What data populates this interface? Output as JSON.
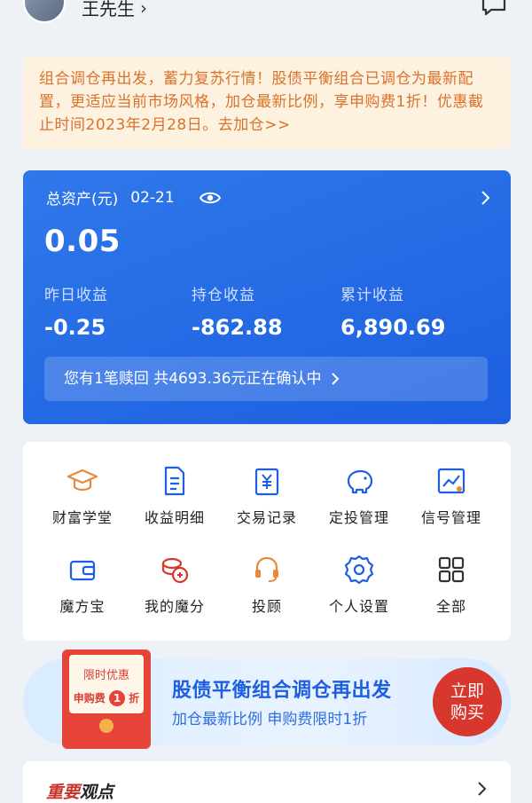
{
  "header": {
    "username": "王先生"
  },
  "notice": {
    "text": "组合调仓再出发，蓄力复苏行情！股债平衡组合已调仓为最新配置，更适应当前市场风格，加仓最新比例，享申购费1折！优惠截止时间2023年2月28日。去加仓>>"
  },
  "asset": {
    "label": "总资产(元)",
    "date": "02-21",
    "total": "0.05",
    "yesterday_label": "昨日收益",
    "yesterday_value": "-0.25",
    "holding_label": "持仓收益",
    "holding_value": "-862.88",
    "cumulative_label": "累计收益",
    "cumulative_value": "6,890.69",
    "redeem_text": "您有1笔赎回 共4693.36元正在确认中"
  },
  "grid": {
    "items": [
      {
        "label": "财富学堂",
        "icon": "graduation-cap-icon"
      },
      {
        "label": "收益明细",
        "icon": "document-icon"
      },
      {
        "label": "交易记录",
        "icon": "yuan-record-icon"
      },
      {
        "label": "定投管理",
        "icon": "piggy-bank-icon"
      },
      {
        "label": "信号管理",
        "icon": "chart-signal-icon"
      },
      {
        "label": "魔方宝",
        "icon": "wallet-icon"
      },
      {
        "label": "我的魔分",
        "icon": "coins-icon"
      },
      {
        "label": "投顾",
        "icon": "headset-icon"
      },
      {
        "label": "个人设置",
        "icon": "gear-icon"
      },
      {
        "label": "全部",
        "icon": "grid-icon"
      }
    ]
  },
  "promo": {
    "tag": "限时优惠",
    "fee_prefix": "申购费",
    "fee_num": "1",
    "fee_suffix": "折",
    "title": "股债平衡组合调仓再出发",
    "subtitle": "加仓最新比例 申购费限时1折",
    "buy_line1": "立即",
    "buy_line2": "购买"
  },
  "views": {
    "title_part1": "重要",
    "title_part2": "观点"
  },
  "colors": {
    "primary": "#1d5fe0",
    "orange": "#e8893a",
    "red": "#d7372c"
  }
}
